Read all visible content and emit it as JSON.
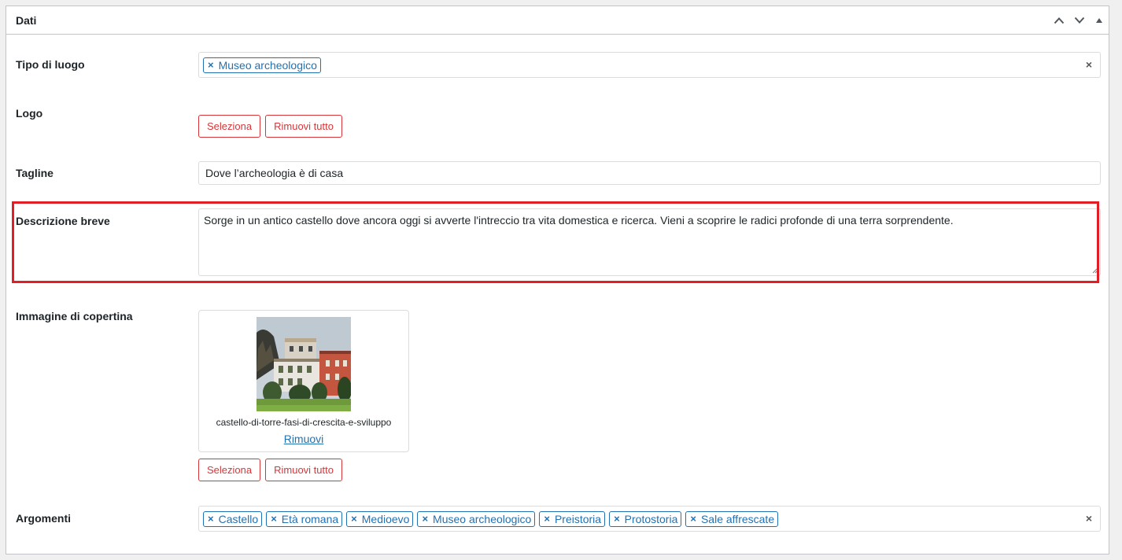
{
  "panel": {
    "title": "Dati",
    "controls": [
      "chevron-up-icon",
      "chevron-down-icon",
      "triangle-up-icon"
    ]
  },
  "tipo_di_luogo": {
    "label": "Tipo di luogo",
    "tags": [
      "Museo archeologico"
    ],
    "tag_remove": "×",
    "clear": "×"
  },
  "logo": {
    "label": "Logo",
    "select_label": "Seleziona",
    "remove_all_label": "Rimuovi tutto"
  },
  "tagline": {
    "label": "Tagline",
    "value": "Dove l’archeologia è di casa"
  },
  "descrizione_breve": {
    "label": "Descrizione breve",
    "value": "Sorge in un antico castello dove ancora oggi si avverte l'intreccio tra vita domestica e ricerca. Vieni a scoprire le radici profonde di una terra sorprendente."
  },
  "immagine_di_copertina": {
    "label": "Immagine di copertina",
    "file_name": "castello-di-torre-fasi-di-crescita-e-sviluppo",
    "remove_link": "Rimuovi",
    "select_label": "Seleziona",
    "remove_all_label": "Rimuovi tutto"
  },
  "argomenti": {
    "label": "Argomenti",
    "tags": [
      "Castello",
      "Età romana",
      "Medioevo",
      "Museo archeologico",
      "Preistoria",
      "Protostoria",
      "Sale affrescate"
    ],
    "tag_remove": "×",
    "clear": "×"
  },
  "colors": {
    "accent": "#2271b1",
    "danger": "#d63638",
    "highlight_border": "#e11d25",
    "border": "#dcdcde"
  }
}
